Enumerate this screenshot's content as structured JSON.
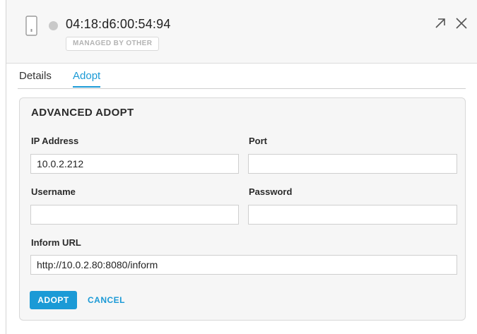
{
  "header": {
    "device_icon": "phone-device-icon",
    "status_color": "#c9c9c9",
    "mac_address": "04:18:d6:00:54:94",
    "badge": "MANAGED BY OTHER",
    "expand_icon": "expand-arrow-icon",
    "close_icon": "close-icon"
  },
  "tabs": [
    {
      "label": "Details",
      "active": false
    },
    {
      "label": "Adopt",
      "active": true
    }
  ],
  "form": {
    "title": "ADVANCED ADOPT",
    "ip_label": "IP Address",
    "ip_value": "10.0.2.212",
    "port_label": "Port",
    "port_value": "",
    "username_label": "Username",
    "username_value": "",
    "password_label": "Password",
    "password_value": "",
    "inform_label": "Inform URL",
    "inform_value": "http://10.0.2.80:8080/inform",
    "adopt_label": "ADOPT",
    "cancel_label": "CANCEL"
  },
  "colors": {
    "accent": "#1b9ad6",
    "badge_text": "#b3b3b3"
  }
}
